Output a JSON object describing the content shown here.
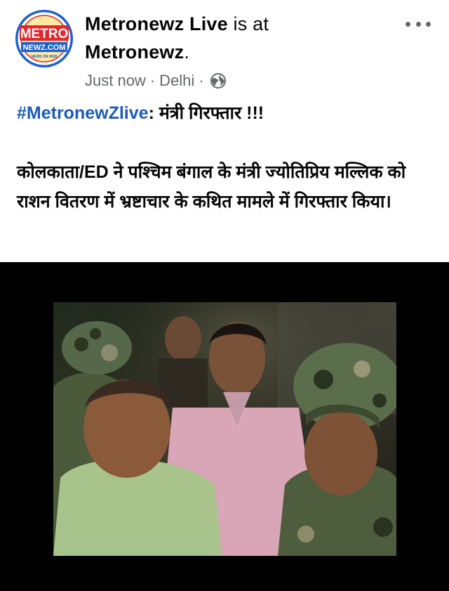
{
  "post": {
    "page_name": "Metronewz Live",
    "is_at": " is at ",
    "location_name": "Metronewz",
    "period": ".",
    "timestamp": "Just now",
    "separator": "·",
    "place": "Delhi",
    "privacy_icon": "globe-icon",
    "more_icon": "more-options-icon",
    "hashtag": "#MetronewZlive",
    "headline": ": मंत्री गिरफ्तार !!!",
    "body": "कोलकाता/ED ने पश्चिम बंगाल के मंत्री ज्योतिप्रिय मल्लिक को राशन वितरण में भ्रष्टाचार के कथित मामले में गिरफ्तार किया।"
  },
  "avatar": {
    "logo_top": "METRO",
    "logo_bottom": "NEWZ.COM",
    "logo_small": "NEWS ON WEB"
  },
  "colors": {
    "hashtag": "#1a5bbd",
    "meta_text": "#65676b",
    "logo_red": "#e5262a",
    "logo_blue": "#1d5fd1"
  }
}
